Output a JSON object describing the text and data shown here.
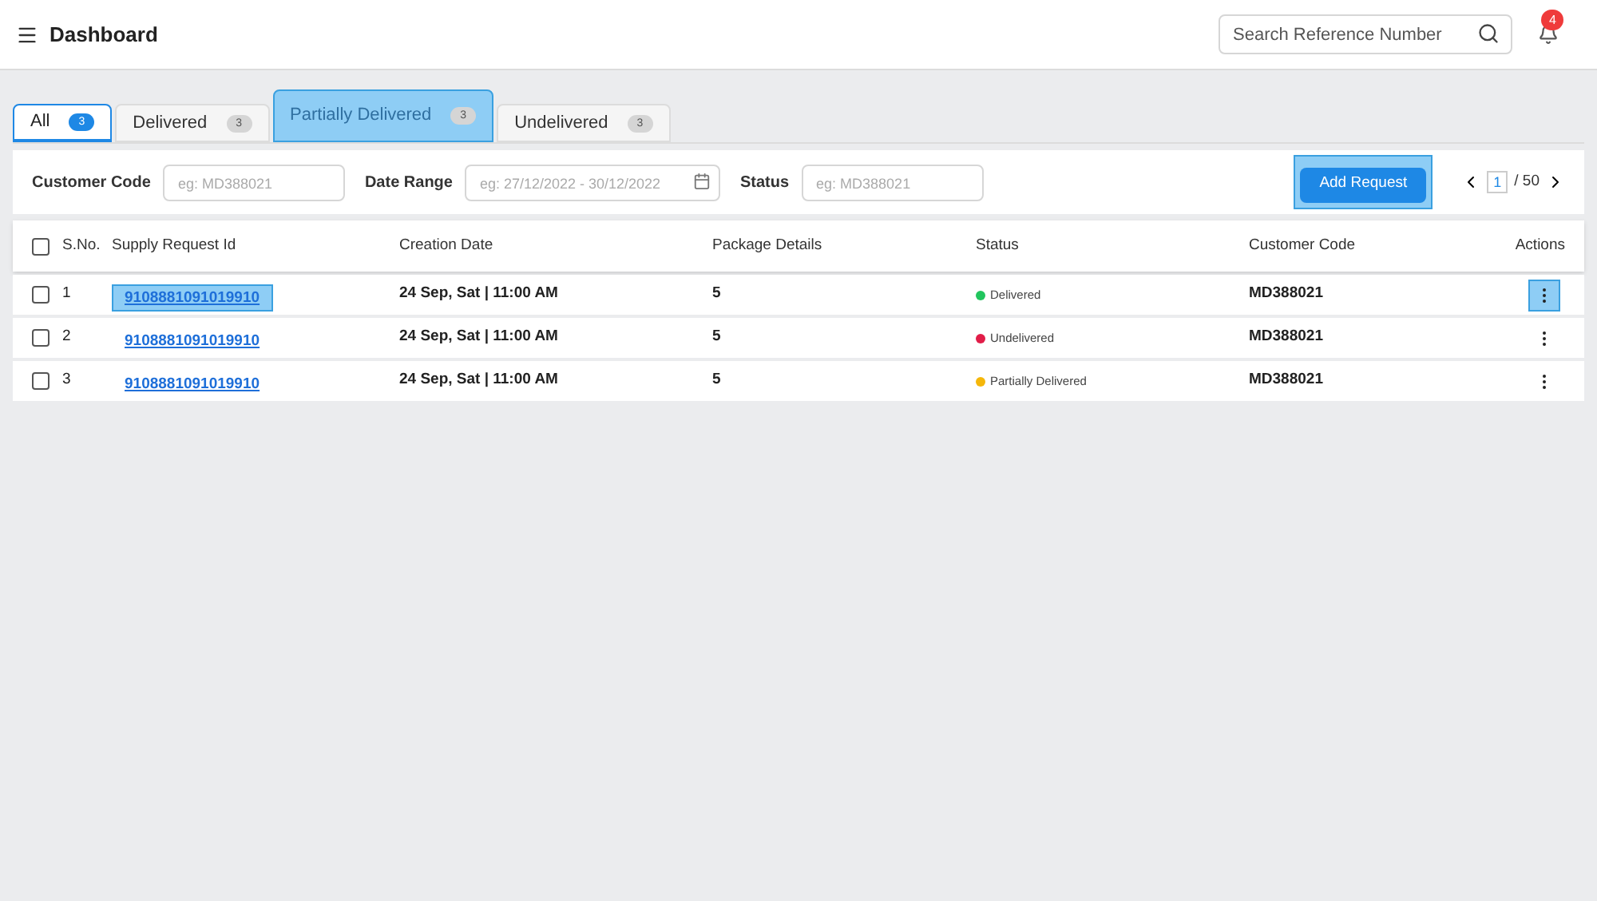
{
  "header": {
    "title": "Dashboard",
    "search": {
      "placeholder": "Search Reference Number"
    },
    "notifications": "4"
  },
  "tabs": [
    {
      "label": "All",
      "count": "3",
      "selected": true,
      "highlighted": false
    },
    {
      "label": "Delivered",
      "count": "3",
      "selected": false,
      "highlighted": false
    },
    {
      "label": "Partially Delivered",
      "count": "3",
      "selected": false,
      "highlighted": true
    },
    {
      "label": "Undelivered",
      "count": "3",
      "selected": false,
      "highlighted": false
    }
  ],
  "filters": {
    "customer_code": {
      "label": "Customer Code",
      "placeholder": "eg: MD388021"
    },
    "date_range": {
      "label": "Date Range",
      "placeholder": "eg: 27/12/2022 - 30/12/2022"
    },
    "status": {
      "label": "Status",
      "placeholder": "eg: MD388021"
    },
    "add_button": {
      "label": "Add Request",
      "highlighted": true
    },
    "pagination": {
      "page": "1",
      "total": "/ 50"
    }
  },
  "table": {
    "select_all_checked": false,
    "columns": [
      "S.No.",
      "Supply Request Id",
      "Creation Date",
      "Package Details",
      "Status",
      "Customer Code",
      "Actions"
    ],
    "rows": [
      {
        "sno": "1",
        "id": "9108881091019910",
        "id_highlighted": true,
        "date": "24 Sep, Sat | 11:00 AM",
        "packages": "5",
        "status": "Delivered",
        "color": "#22c55e",
        "customer": "MD388021",
        "actions_highlighted": true,
        "checked": false
      },
      {
        "sno": "2",
        "id": "9108881091019910",
        "id_highlighted": false,
        "date": "24 Sep, Sat | 11:00 AM",
        "packages": "5",
        "status": "Undelivered",
        "color": "#e11d48",
        "customer": "MD388021",
        "actions_highlighted": false,
        "checked": false
      },
      {
        "sno": "3",
        "id": "9108881091019910",
        "id_highlighted": false,
        "date": "24 Sep, Sat | 11:00 AM",
        "packages": "5",
        "status": "Partially Delivered",
        "color": "#f5b70a",
        "customer": "MD388021",
        "actions_highlighted": false,
        "checked": false
      }
    ]
  }
}
